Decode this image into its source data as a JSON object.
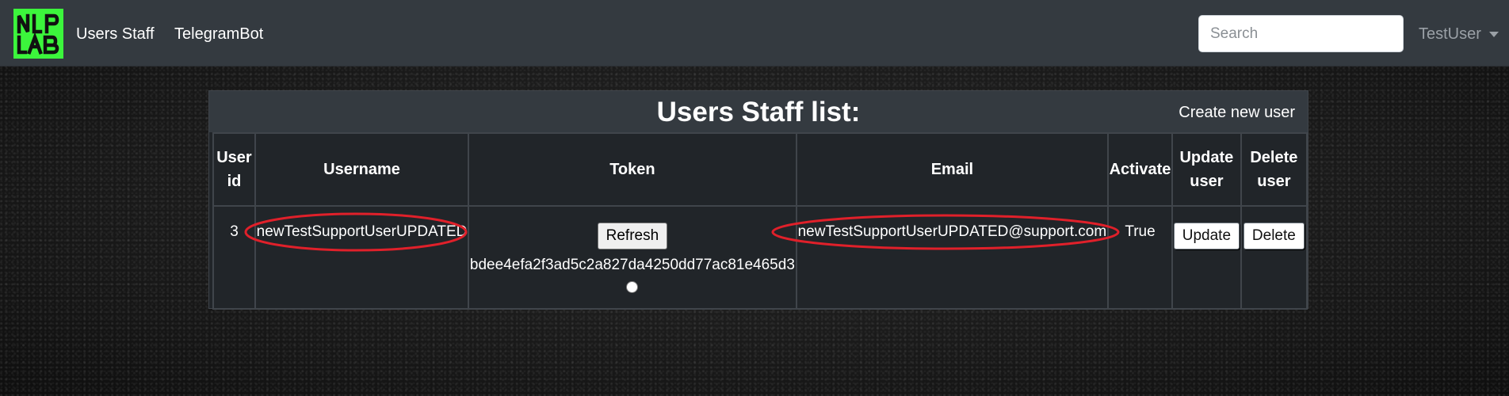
{
  "navbar": {
    "logo_text": "NLP LAB",
    "links": [
      "Users Staff",
      "TelegramBot"
    ],
    "search_placeholder": "Search",
    "user_menu": "TestUser",
    "logo_color": "#3cf53c"
  },
  "card": {
    "title": "Users Staff list:",
    "create_link": "Create new user"
  },
  "table": {
    "headers": [
      "User id",
      "Username",
      "Token",
      "Email",
      "Activate",
      "Update user",
      "Delete user"
    ],
    "rows": [
      {
        "user_id": "3",
        "username": "newTestSupportUserUPDATED",
        "refresh_label": "Refresh",
        "token": "bdee4efa2f3ad5c2a827da4250dd77ac81e465d3",
        "email": "newTestSupportUserUPDATED@support.com",
        "activate": "True",
        "update_label": "Update",
        "delete_label": "Delete"
      }
    ]
  },
  "annotation_color": "#e0202a"
}
